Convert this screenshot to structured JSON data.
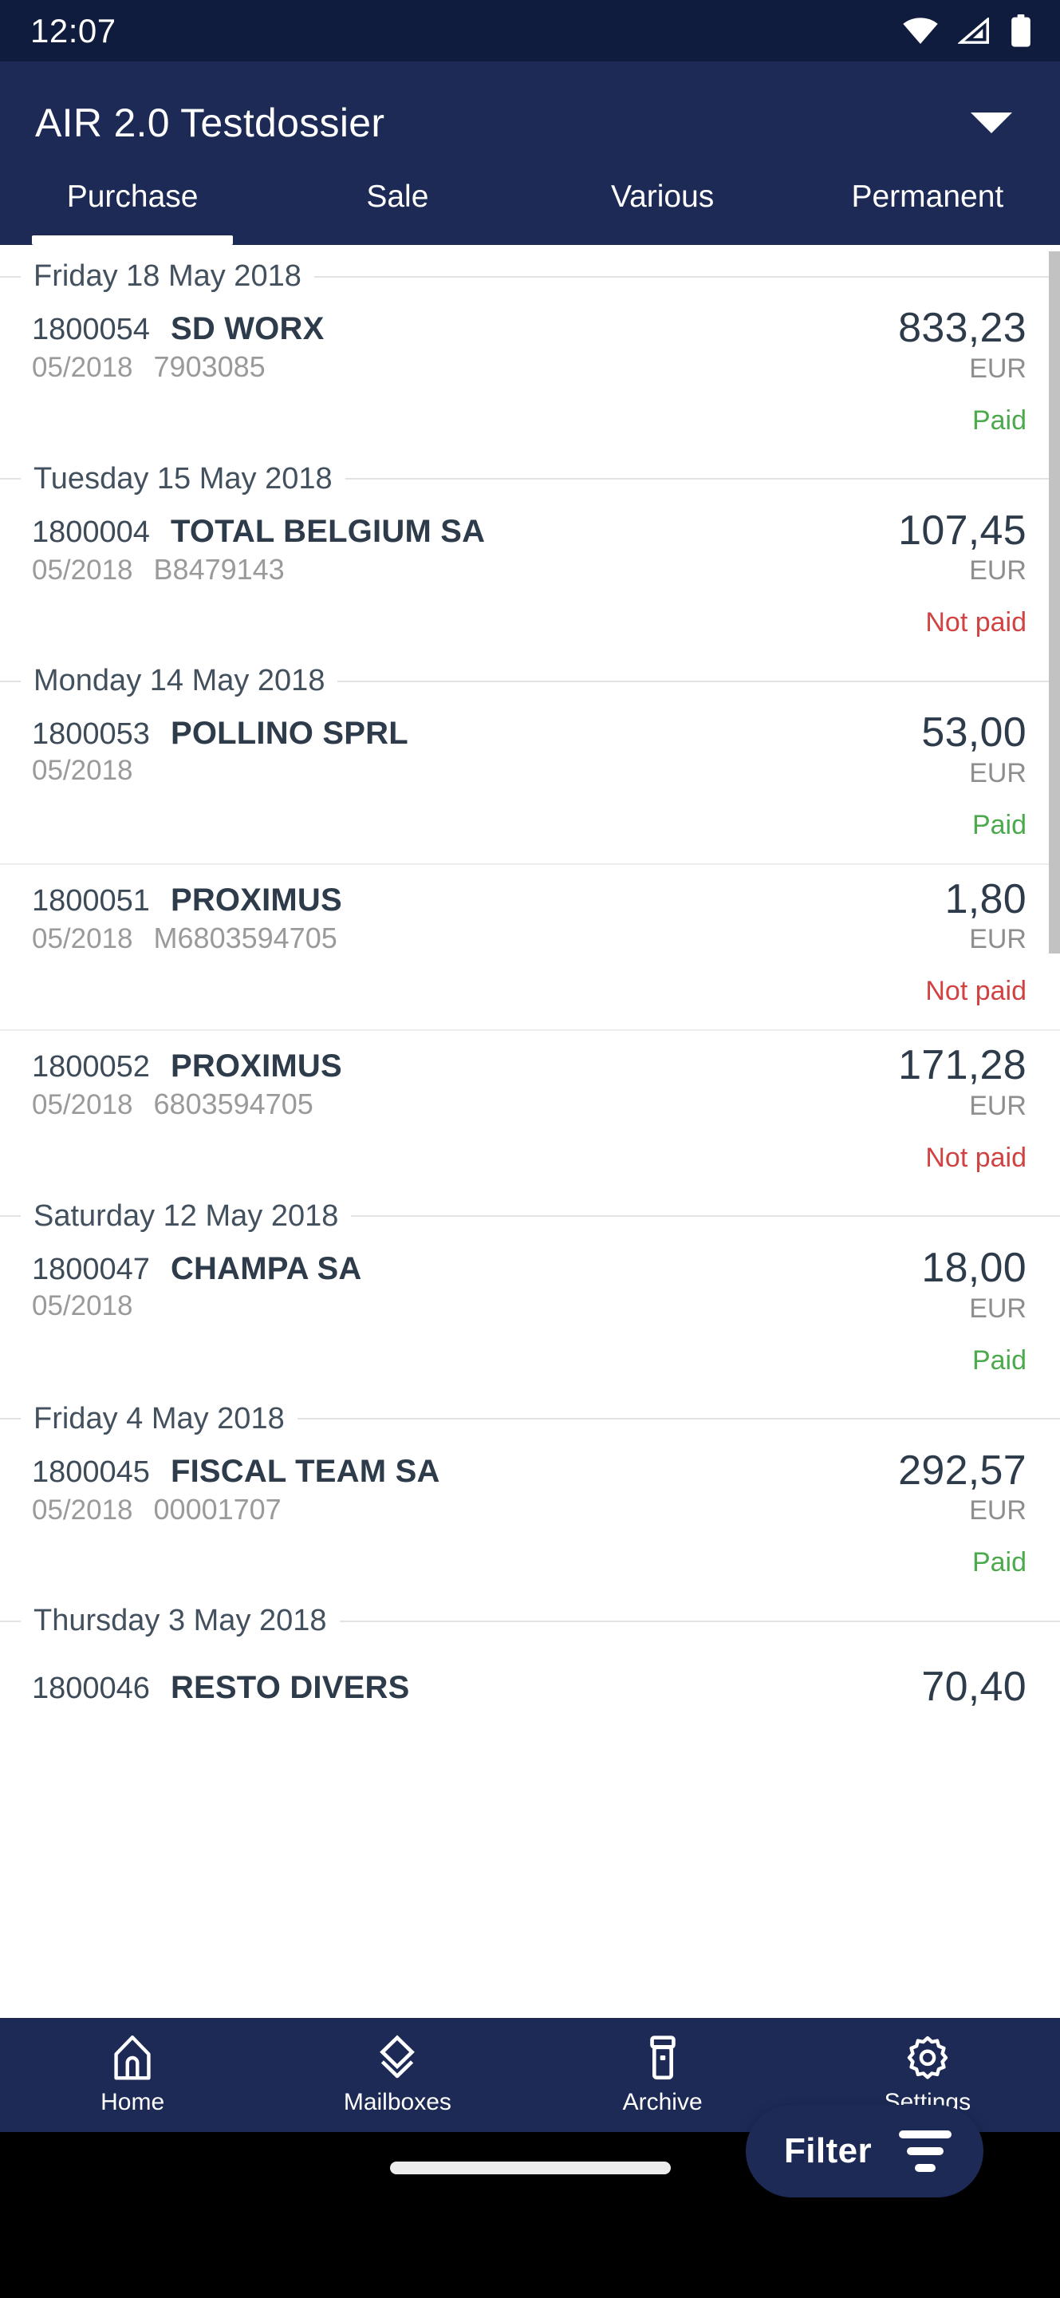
{
  "status_bar": {
    "time": "12:07",
    "icons": [
      "wifi-icon",
      "cell-signal-icon",
      "battery-icon"
    ]
  },
  "app_bar": {
    "title": "AIR 2.0 Testdossier",
    "dropdown_icon": "chevron-down-icon"
  },
  "tabs": [
    {
      "label": "Purchase",
      "active": true
    },
    {
      "label": "Sale",
      "active": false
    },
    {
      "label": "Various",
      "active": false
    },
    {
      "label": "Permanent",
      "active": false
    }
  ],
  "list": {
    "currency": "EUR",
    "groups": [
      {
        "date": "Friday 18 May 2018",
        "entries": [
          {
            "doc_no": "1800054",
            "supplier": "SD WORX",
            "period": "05/2018",
            "reference": "7903085",
            "amount": "833,23",
            "currency": "EUR",
            "status": "Paid",
            "status_type": "paid"
          }
        ]
      },
      {
        "date": "Tuesday 15 May 2018",
        "entries": [
          {
            "doc_no": "1800004",
            "supplier": "TOTAL BELGIUM SA",
            "period": "05/2018",
            "reference": "B8479143",
            "amount": "107,45",
            "currency": "EUR",
            "status": "Not paid",
            "status_type": "notpaid"
          }
        ]
      },
      {
        "date": "Monday 14 May 2018",
        "entries": [
          {
            "doc_no": "1800053",
            "supplier": "POLLINO SPRL",
            "period": "05/2018",
            "reference": "",
            "amount": "53,00",
            "currency": "EUR",
            "status": "Paid",
            "status_type": "paid"
          },
          {
            "doc_no": "1800051",
            "supplier": "PROXIMUS",
            "period": "05/2018",
            "reference": "M6803594705",
            "amount": "1,80",
            "currency": "EUR",
            "status": "Not paid",
            "status_type": "notpaid"
          },
          {
            "doc_no": "1800052",
            "supplier": "PROXIMUS",
            "period": "05/2018",
            "reference": "6803594705",
            "amount": "171,28",
            "currency": "EUR",
            "status": "Not paid",
            "status_type": "notpaid"
          }
        ]
      },
      {
        "date": "Saturday 12 May 2018",
        "entries": [
          {
            "doc_no": "1800047",
            "supplier": "CHAMPA SA",
            "period": "05/2018",
            "reference": "",
            "amount": "18,00",
            "currency": "EUR",
            "status": "Paid",
            "status_type": "paid"
          }
        ]
      },
      {
        "date": "Friday 4 May 2018",
        "entries": [
          {
            "doc_no": "1800045",
            "supplier": "FISCAL TEAM SA",
            "period": "05/2018",
            "reference": "00001707",
            "amount": "292,57",
            "currency": "EUR",
            "status": "Paid",
            "status_type": "paid"
          }
        ]
      },
      {
        "date": "Thursday 3 May 2018",
        "entries": [
          {
            "doc_no": "1800046",
            "supplier": "RESTO DIVERS",
            "period": "",
            "reference": "",
            "amount": "70,40",
            "currency": "",
            "status": "",
            "status_type": "paid",
            "clipped": true
          }
        ]
      }
    ]
  },
  "filter_button": {
    "label": "Filter",
    "icon": "filter-icon"
  },
  "bottom_nav": [
    {
      "label": "Home",
      "icon": "home-icon"
    },
    {
      "label": "Mailboxes",
      "icon": "layers-icon"
    },
    {
      "label": "Archive",
      "icon": "archive-box-icon"
    },
    {
      "label": "Settings",
      "icon": "gear-icon"
    }
  ],
  "colors": {
    "status_bar_bg": "#101c3d",
    "app_bar_bg": "#1c2a55",
    "paid": "#4da94d",
    "not_paid": "#d14343",
    "accent": "#1c2a55"
  }
}
